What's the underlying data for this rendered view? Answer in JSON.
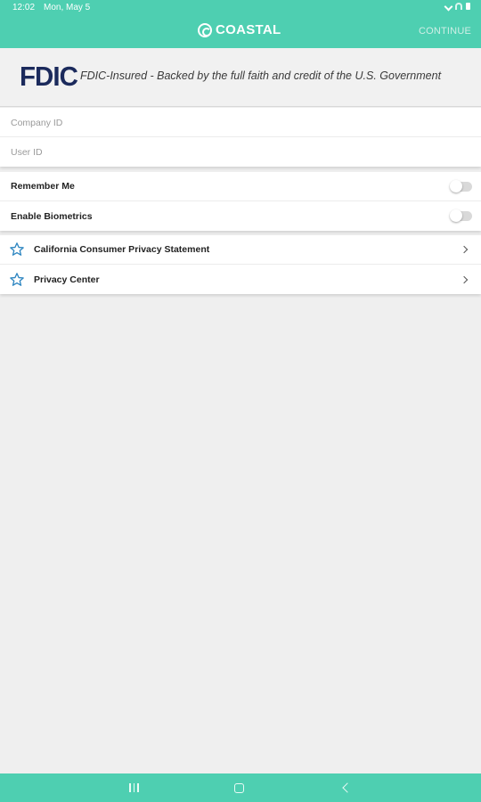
{
  "status_bar": {
    "time": "12:02",
    "date": "Mon, May 5"
  },
  "app_bar": {
    "brand": "COASTAL",
    "continue_label": "CONTINUE"
  },
  "fdic": {
    "logo_text": "FDIC",
    "tagline": "FDIC-Insured - Backed by the full faith and credit of the U.S. Government"
  },
  "login": {
    "company_id_placeholder": "Company ID",
    "user_id_placeholder": "User ID"
  },
  "settings": {
    "remember_me_label": "Remember Me",
    "remember_me_enabled": false,
    "biometrics_label": "Enable Biometrics",
    "biometrics_enabled": false
  },
  "links": [
    {
      "label": "California Consumer Privacy Statement",
      "icon": "star-outline-icon"
    },
    {
      "label": "Privacy Center",
      "icon": "star-outline-icon"
    }
  ],
  "colors": {
    "brand_teal": "#4ecfb1",
    "fdic_navy": "#1b2a5c",
    "background": "#efefef",
    "star_blue": "#2e86c1"
  }
}
